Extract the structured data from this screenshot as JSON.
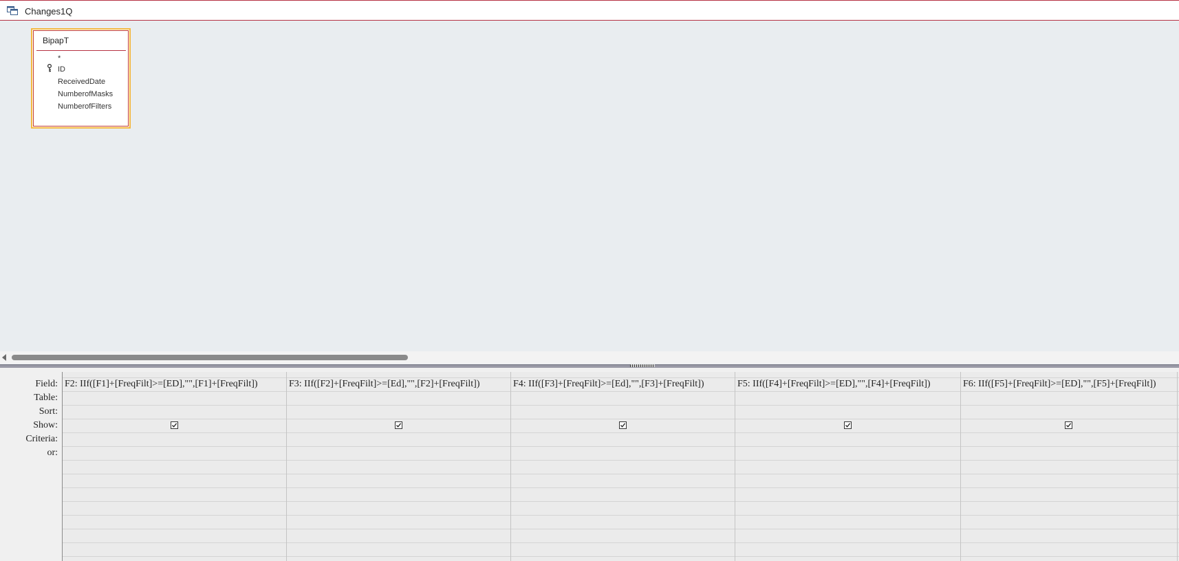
{
  "window": {
    "title": "Changes1Q",
    "icon": "query-design-icon"
  },
  "table_box": {
    "name": "BipapT",
    "fields": [
      "*",
      "ID",
      "ReceivedDate",
      "NumberofMasks",
      "NumberofFilters"
    ],
    "primary_key_field": "ID"
  },
  "design_grid": {
    "row_labels": [
      "Field:",
      "Table:",
      "Sort:",
      "Show:",
      "Criteria:",
      "or:"
    ],
    "columns": [
      {
        "field": "F2: IIf([F1]+[FreqFilt]>=[ED],\"\",[F1]+[FreqFilt])",
        "table": "",
        "sort": "",
        "show": true,
        "criteria": "",
        "or": ""
      },
      {
        "field": "F3: IIf([F2]+[FreqFilt]>=[Ed],\"\",[F2]+[FreqFilt])",
        "table": "",
        "sort": "",
        "show": true,
        "criteria": "",
        "or": ""
      },
      {
        "field": "F4: IIf([F3]+[FreqFilt]>=[Ed],\"\",[F3]+[FreqFilt])",
        "table": "",
        "sort": "",
        "show": true,
        "criteria": "",
        "or": ""
      },
      {
        "field": "F5: IIf([F4]+[FreqFilt]>=[ED],\"\",[F4]+[FreqFilt])",
        "table": "",
        "sort": "",
        "show": true,
        "criteria": "",
        "or": ""
      },
      {
        "field": "F6: IIf([F5]+[FreqFilt]>=[ED],\"\",[F5]+[FreqFilt])",
        "table": "",
        "sort": "",
        "show": true,
        "criteria": "",
        "or": ""
      }
    ]
  },
  "colors": {
    "accent_border": "#b53142",
    "selected_table_border": "#f4b942",
    "background": "#e9edf0"
  }
}
